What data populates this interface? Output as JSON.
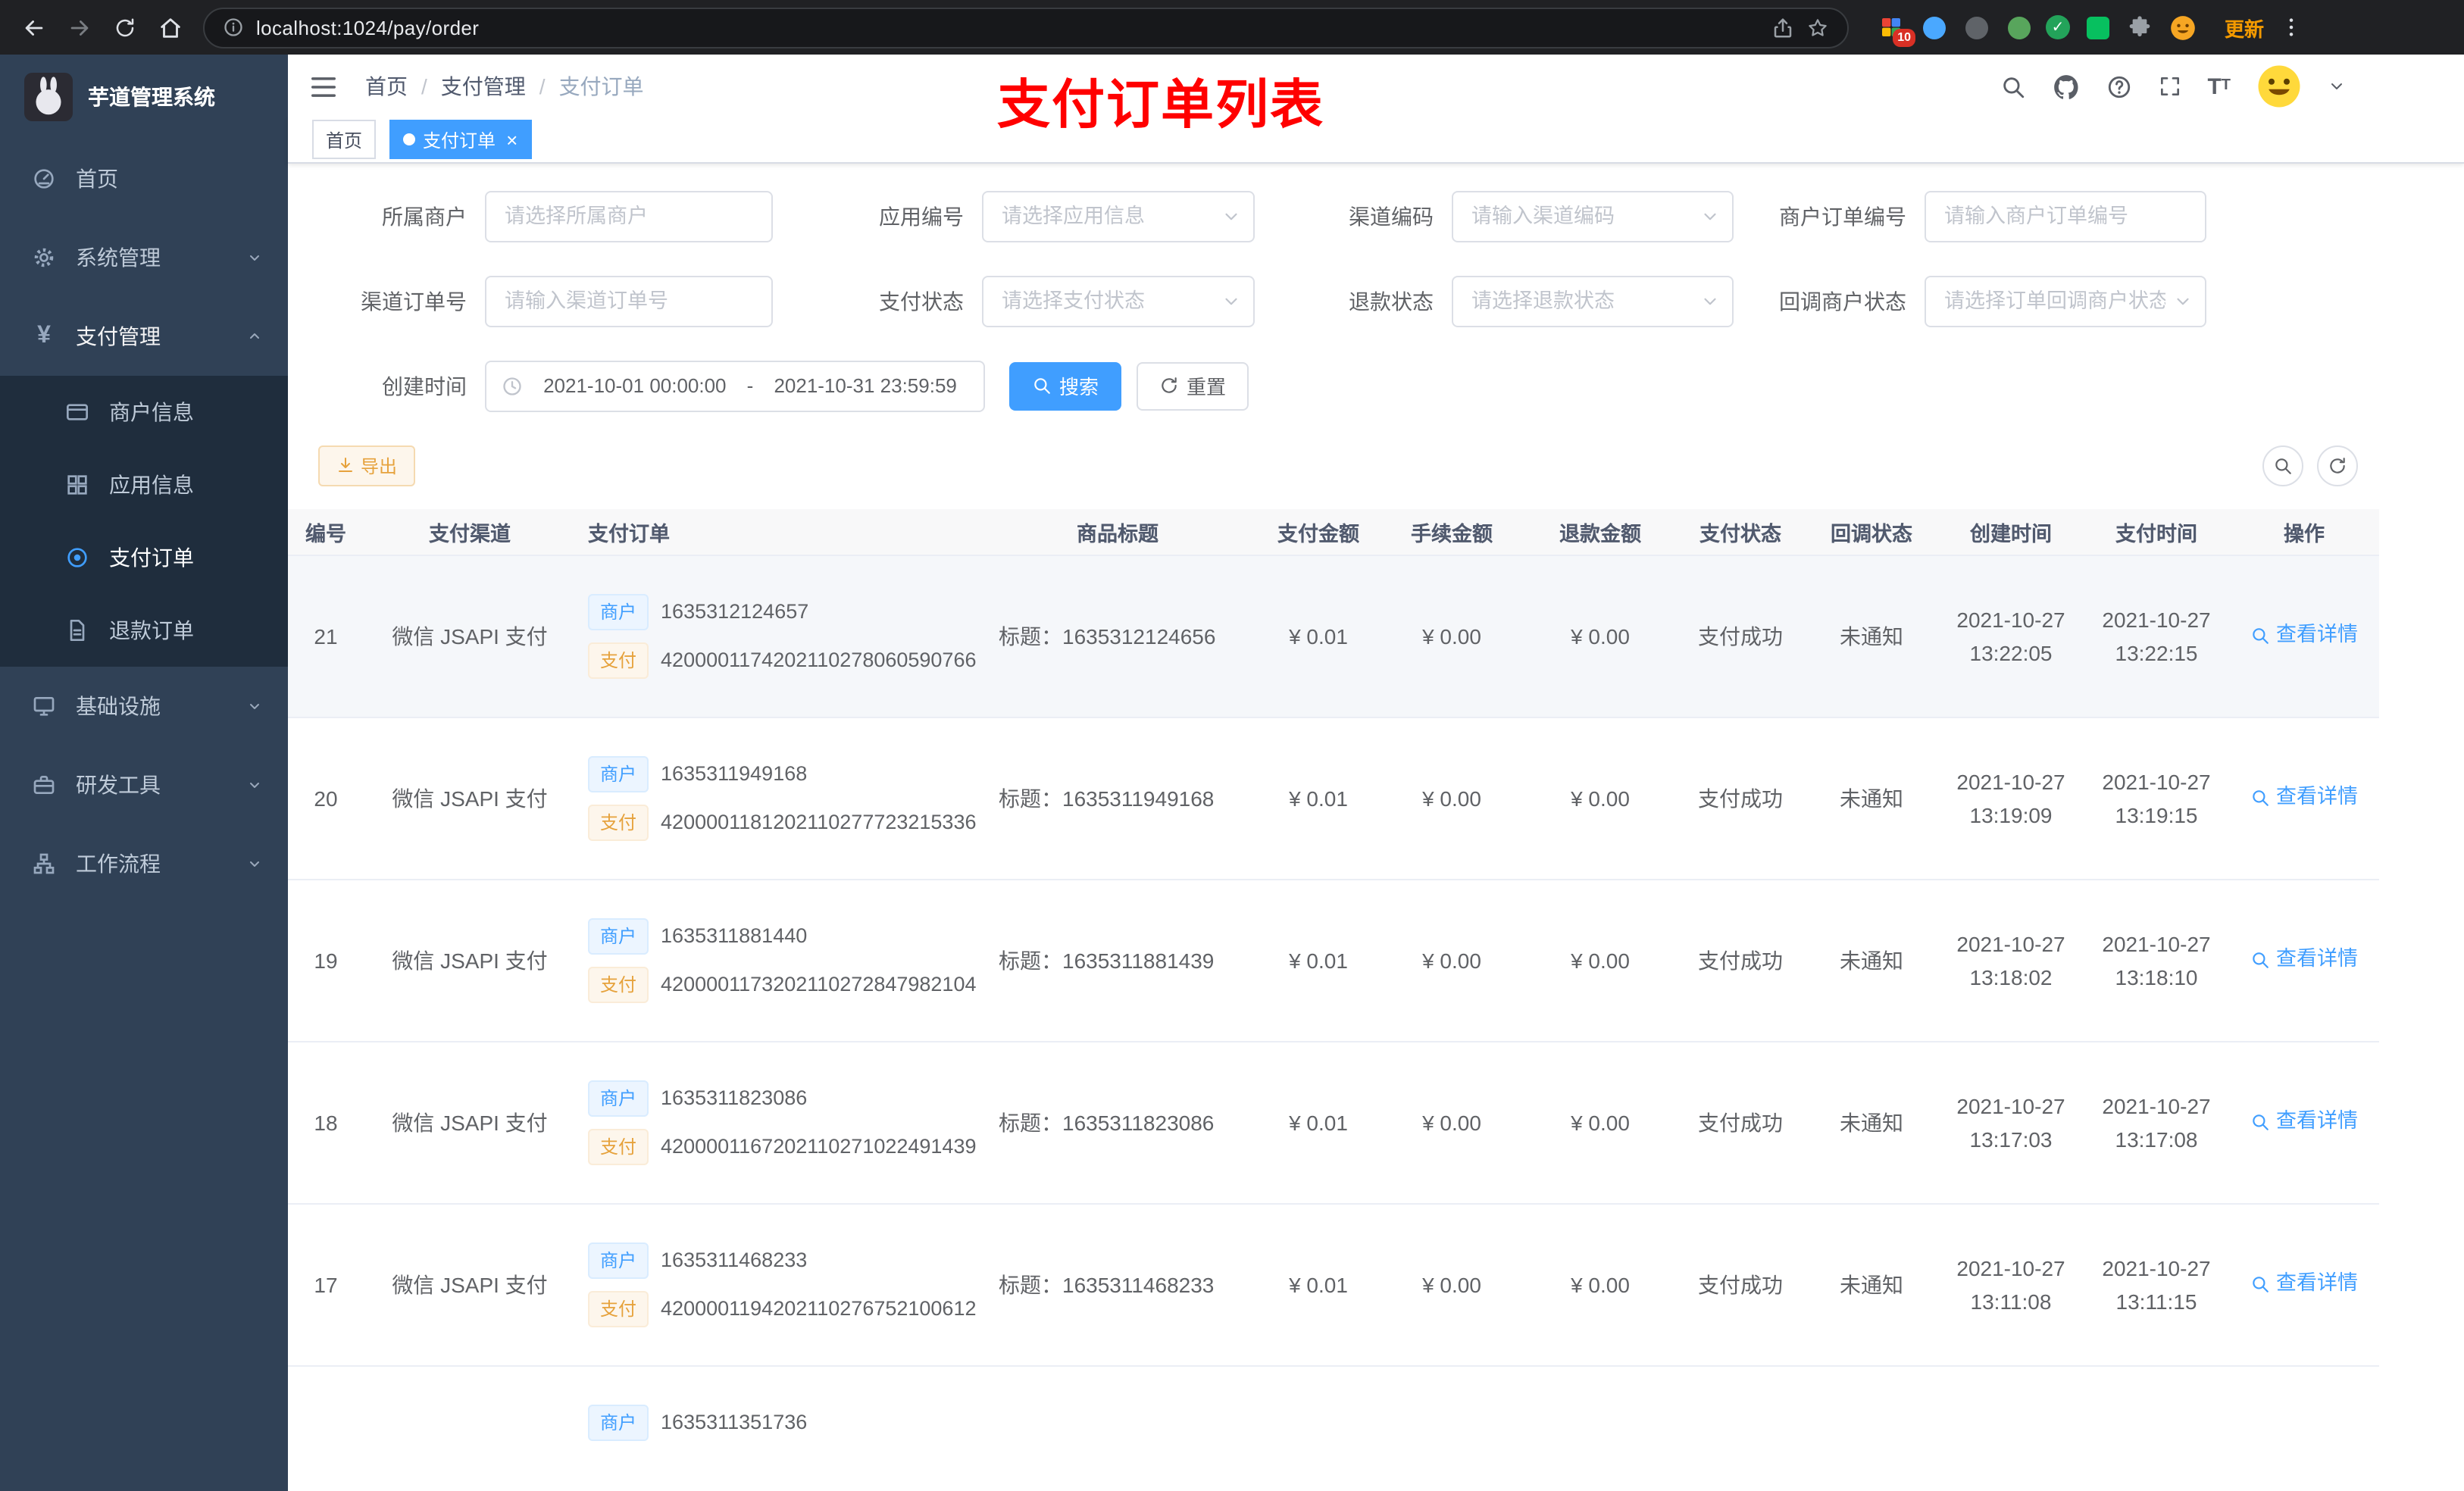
{
  "colors": {
    "accent": "#409eff",
    "warning": "#e6a23c",
    "annotation_red": "#ff0000",
    "sidebar_bg": "#304156",
    "submenu_bg": "#1f2d3d"
  },
  "browser": {
    "url": "localhost:1024/pay/order",
    "update_label": "更新",
    "extension_badge": "10"
  },
  "app": {
    "logo_title": "芋道管理系统"
  },
  "sidebar": {
    "items": [
      {
        "label": "首页",
        "icon": "dashboard-icon"
      },
      {
        "label": "系统管理",
        "icon": "gear-icon"
      },
      {
        "label": "支付管理",
        "icon": "yen-icon"
      },
      {
        "label": "商户信息",
        "icon": "card-icon"
      },
      {
        "label": "应用信息",
        "icon": "grid-icon"
      },
      {
        "label": "支付订单",
        "icon": "target-icon"
      },
      {
        "label": "退款订单",
        "icon": "document-icon"
      },
      {
        "label": "基础设施",
        "icon": "monitor-icon"
      },
      {
        "label": "研发工具",
        "icon": "toolbox-icon"
      },
      {
        "label": "工作流程",
        "icon": "workflow-icon"
      }
    ]
  },
  "header": {
    "breadcrumb": [
      "首页",
      "支付管理",
      "支付订单"
    ],
    "annotation": "支付订单列表"
  },
  "tabs": [
    {
      "label": "首页"
    },
    {
      "label": "支付订单"
    }
  ],
  "filters": {
    "fields": [
      {
        "label": "所属商户",
        "placeholder": "请选择所属商户"
      },
      {
        "label": "应用编号",
        "placeholder": "请选择应用信息"
      },
      {
        "label": "渠道编码",
        "placeholder": "请输入渠道编码"
      },
      {
        "label": "商户订单编号",
        "placeholder": "请输入商户订单编号"
      },
      {
        "label": "渠道订单号",
        "placeholder": "请输入渠道订单号"
      },
      {
        "label": "支付状态",
        "placeholder": "请选择支付状态"
      },
      {
        "label": "退款状态",
        "placeholder": "请选择退款状态"
      },
      {
        "label": "回调商户状态",
        "placeholder": "请选择订单回调商户状态"
      }
    ],
    "date_label": "创建时间",
    "date_start": "2021-10-01 00:00:00",
    "date_separator": "-",
    "date_end": "2021-10-31 23:59:59",
    "search_label": "搜索",
    "reset_label": "重置"
  },
  "toolbar": {
    "export_label": "导出"
  },
  "table": {
    "columns": [
      "编号",
      "支付渠道",
      "支付订单",
      "商品标题",
      "支付金额",
      "手续金额",
      "退款金额",
      "支付状态",
      "回调状态",
      "创建时间",
      "支付时间",
      "操作"
    ],
    "rows": [
      {
        "id": "21",
        "channel": "微信 JSAPI 支付",
        "merchant_tag": "商户",
        "merchant_no": "1635312124657",
        "pay_tag": "支付",
        "pay_no": "4200001174202110278060590766",
        "title": "标题：1635312124656",
        "amount": "¥ 0.01",
        "fee": "¥ 0.00",
        "refund": "¥ 0.00",
        "status": "支付成功",
        "notify": "未通知",
        "create_date": "2021-10-27",
        "create_time": "13:22:05",
        "pay_date": "2021-10-27",
        "pay_time": "13:22:15",
        "action": "查看详情"
      },
      {
        "id": "20",
        "channel": "微信 JSAPI 支付",
        "merchant_tag": "商户",
        "merchant_no": "1635311949168",
        "pay_tag": "支付",
        "pay_no": "4200001181202110277723215336",
        "title": "标题：1635311949168",
        "amount": "¥ 0.01",
        "fee": "¥ 0.00",
        "refund": "¥ 0.00",
        "status": "支付成功",
        "notify": "未通知",
        "create_date": "2021-10-27",
        "create_time": "13:19:09",
        "pay_date": "2021-10-27",
        "pay_time": "13:19:15",
        "action": "查看详情"
      },
      {
        "id": "19",
        "channel": "微信 JSAPI 支付",
        "merchant_tag": "商户",
        "merchant_no": "1635311881440",
        "pay_tag": "支付",
        "pay_no": "4200001173202110272847982104",
        "title": "标题：1635311881439",
        "amount": "¥ 0.01",
        "fee": "¥ 0.00",
        "refund": "¥ 0.00",
        "status": "支付成功",
        "notify": "未通知",
        "create_date": "2021-10-27",
        "create_time": "13:18:02",
        "pay_date": "2021-10-27",
        "pay_time": "13:18:10",
        "action": "查看详情"
      },
      {
        "id": "18",
        "channel": "微信 JSAPI 支付",
        "merchant_tag": "商户",
        "merchant_no": "1635311823086",
        "pay_tag": "支付",
        "pay_no": "4200001167202110271022491439",
        "title": "标题：1635311823086",
        "amount": "¥ 0.01",
        "fee": "¥ 0.00",
        "refund": "¥ 0.00",
        "status": "支付成功",
        "notify": "未通知",
        "create_date": "2021-10-27",
        "create_time": "13:17:03",
        "pay_date": "2021-10-27",
        "pay_time": "13:17:08",
        "action": "查看详情"
      },
      {
        "id": "17",
        "channel": "微信 JSAPI 支付",
        "merchant_tag": "商户",
        "merchant_no": "1635311468233",
        "pay_tag": "支付",
        "pay_no": "4200001194202110276752100612",
        "title": "标题：1635311468233",
        "amount": "¥ 0.01",
        "fee": "¥ 0.00",
        "refund": "¥ 0.00",
        "status": "支付成功",
        "notify": "未通知",
        "create_date": "2021-10-27",
        "create_time": "13:11:08",
        "pay_date": "2021-10-27",
        "pay_time": "13:11:15",
        "action": "查看详情"
      },
      {
        "id": "",
        "channel": "",
        "merchant_tag": "商户",
        "merchant_no": "1635311351736",
        "pay_tag": "",
        "pay_no": "",
        "title": "",
        "amount": "",
        "fee": "",
        "refund": "",
        "status": "",
        "notify": "",
        "create_date": "",
        "create_time": "",
        "pay_date": "",
        "pay_time": "",
        "action": ""
      }
    ]
  }
}
